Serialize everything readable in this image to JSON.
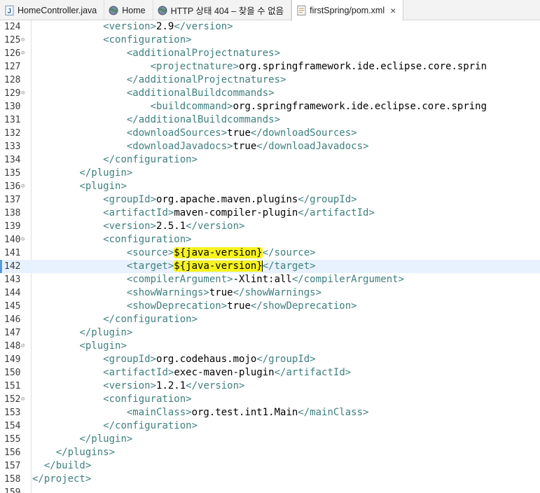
{
  "tabs": [
    {
      "label": "HomeController.java",
      "icon": "java-file-icon",
      "active": false
    },
    {
      "label": "Home",
      "icon": "globe-icon",
      "active": false
    },
    {
      "label": "HTTP 상태 404 – 찾을 수 없음",
      "icon": "globe-icon",
      "active": false
    },
    {
      "label": "firstSpring/pom.xml",
      "icon": "xml-file-icon",
      "active": true,
      "close": "×"
    }
  ],
  "editor": {
    "current_line": 142,
    "lines": [
      {
        "n": "124",
        "fold": false,
        "indent": "            ",
        "parts": [
          [
            "tag",
            "<version>"
          ],
          [
            "txt",
            "2.9"
          ],
          [
            "tag",
            "</version>"
          ]
        ]
      },
      {
        "n": "125",
        "fold": true,
        "indent": "            ",
        "parts": [
          [
            "tag",
            "<configuration>"
          ]
        ]
      },
      {
        "n": "126",
        "fold": true,
        "indent": "                ",
        "parts": [
          [
            "tag",
            "<additionalProjectnatures>"
          ]
        ]
      },
      {
        "n": "127",
        "fold": false,
        "indent": "                    ",
        "parts": [
          [
            "tag",
            "<projectnature>"
          ],
          [
            "txt",
            "org.springframework.ide.eclipse.core.sprin"
          ]
        ]
      },
      {
        "n": "128",
        "fold": false,
        "indent": "                ",
        "parts": [
          [
            "tag",
            "</additionalProjectnatures>"
          ]
        ]
      },
      {
        "n": "129",
        "fold": true,
        "indent": "                ",
        "parts": [
          [
            "tag",
            "<additionalBuildcommands>"
          ]
        ]
      },
      {
        "n": "130",
        "fold": false,
        "indent": "                    ",
        "parts": [
          [
            "tag",
            "<buildcommand>"
          ],
          [
            "txt",
            "org.springframework.ide.eclipse.core.spring"
          ]
        ]
      },
      {
        "n": "131",
        "fold": false,
        "indent": "                ",
        "parts": [
          [
            "tag",
            "</additionalBuildcommands>"
          ]
        ]
      },
      {
        "n": "132",
        "fold": false,
        "indent": "                ",
        "parts": [
          [
            "tag",
            "<downloadSources>"
          ],
          [
            "txt",
            "true"
          ],
          [
            "tag",
            "</downloadSources>"
          ]
        ]
      },
      {
        "n": "133",
        "fold": false,
        "indent": "                ",
        "parts": [
          [
            "tag",
            "<downloadJavadocs>"
          ],
          [
            "txt",
            "true"
          ],
          [
            "tag",
            "</downloadJavadocs>"
          ]
        ]
      },
      {
        "n": "134",
        "fold": false,
        "indent": "            ",
        "parts": [
          [
            "tag",
            "</configuration>"
          ]
        ]
      },
      {
        "n": "135",
        "fold": false,
        "indent": "        ",
        "parts": [
          [
            "tag",
            "</plugin>"
          ]
        ]
      },
      {
        "n": "136",
        "fold": true,
        "indent": "        ",
        "parts": [
          [
            "tag",
            "<plugin>"
          ]
        ]
      },
      {
        "n": "137",
        "fold": false,
        "indent": "            ",
        "parts": [
          [
            "tag",
            "<groupId>"
          ],
          [
            "txt",
            "org.apache.maven.plugins"
          ],
          [
            "tag",
            "</groupId>"
          ]
        ]
      },
      {
        "n": "138",
        "fold": false,
        "indent": "            ",
        "parts": [
          [
            "tag",
            "<artifactId>"
          ],
          [
            "txt",
            "maven-compiler-plugin"
          ],
          [
            "tag",
            "</artifactId>"
          ]
        ]
      },
      {
        "n": "139",
        "fold": false,
        "indent": "            ",
        "parts": [
          [
            "tag",
            "<version>"
          ],
          [
            "txt",
            "2.5.1"
          ],
          [
            "tag",
            "</version>"
          ]
        ]
      },
      {
        "n": "140",
        "fold": true,
        "indent": "            ",
        "parts": [
          [
            "tag",
            "<configuration>"
          ]
        ]
      },
      {
        "n": "141",
        "fold": false,
        "indent": "                ",
        "parts": [
          [
            "tag",
            "<source>"
          ],
          [
            "hl",
            "${java-version}"
          ],
          [
            "tag",
            "</source>"
          ]
        ]
      },
      {
        "n": "142",
        "fold": false,
        "indent": "                ",
        "parts": [
          [
            "tag",
            "<target>"
          ],
          [
            "hl",
            "${java-version}"
          ],
          [
            "caret",
            ""
          ],
          [
            "tag",
            "</target>"
          ]
        ]
      },
      {
        "n": "143",
        "fold": false,
        "indent": "                ",
        "parts": [
          [
            "tag",
            "<compilerArgument>"
          ],
          [
            "txt",
            "-Xlint:all"
          ],
          [
            "tag",
            "</compilerArgument>"
          ]
        ]
      },
      {
        "n": "144",
        "fold": false,
        "indent": "                ",
        "parts": [
          [
            "tag",
            "<showWarnings>"
          ],
          [
            "txt",
            "true"
          ],
          [
            "tag",
            "</showWarnings>"
          ]
        ]
      },
      {
        "n": "145",
        "fold": false,
        "indent": "                ",
        "parts": [
          [
            "tag",
            "<showDeprecation>"
          ],
          [
            "txt",
            "true"
          ],
          [
            "tag",
            "</showDeprecation>"
          ]
        ]
      },
      {
        "n": "146",
        "fold": false,
        "indent": "            ",
        "parts": [
          [
            "tag",
            "</configuration>"
          ]
        ]
      },
      {
        "n": "147",
        "fold": false,
        "indent": "        ",
        "parts": [
          [
            "tag",
            "</plugin>"
          ]
        ]
      },
      {
        "n": "148",
        "fold": true,
        "indent": "        ",
        "parts": [
          [
            "tag",
            "<plugin>"
          ]
        ]
      },
      {
        "n": "149",
        "fold": false,
        "indent": "            ",
        "parts": [
          [
            "tag",
            "<groupId>"
          ],
          [
            "txt",
            "org.codehaus.mojo"
          ],
          [
            "tag",
            "</groupId>"
          ]
        ]
      },
      {
        "n": "150",
        "fold": false,
        "indent": "            ",
        "parts": [
          [
            "tag",
            "<artifactId>"
          ],
          [
            "txt",
            "exec-maven-plugin"
          ],
          [
            "tag",
            "</artifactId>"
          ]
        ]
      },
      {
        "n": "151",
        "fold": false,
        "indent": "            ",
        "parts": [
          [
            "tag",
            "<version>"
          ],
          [
            "txt",
            "1.2.1"
          ],
          [
            "tag",
            "</version>"
          ]
        ]
      },
      {
        "n": "152",
        "fold": true,
        "indent": "            ",
        "parts": [
          [
            "tag",
            "<configuration>"
          ]
        ]
      },
      {
        "n": "153",
        "fold": false,
        "indent": "                ",
        "parts": [
          [
            "tag",
            "<mainClass>"
          ],
          [
            "txt",
            "org.test.int1.Main"
          ],
          [
            "tag",
            "</mainClass>"
          ]
        ]
      },
      {
        "n": "154",
        "fold": false,
        "indent": "            ",
        "parts": [
          [
            "tag",
            "</configuration>"
          ]
        ]
      },
      {
        "n": "155",
        "fold": false,
        "indent": "        ",
        "parts": [
          [
            "tag",
            "</plugin>"
          ]
        ]
      },
      {
        "n": "156",
        "fold": false,
        "indent": "    ",
        "parts": [
          [
            "tag",
            "</plugins>"
          ]
        ]
      },
      {
        "n": "157",
        "fold": false,
        "indent": "  ",
        "parts": [
          [
            "tag",
            "</build>"
          ]
        ]
      },
      {
        "n": "158",
        "fold": false,
        "indent": "",
        "parts": [
          [
            "tag",
            "</project>"
          ]
        ]
      },
      {
        "n": "159",
        "fold": false,
        "indent": "",
        "parts": []
      }
    ]
  },
  "colors": {
    "tag": "#3f7f7f",
    "text": "#000000",
    "highlight": "#f7f31f",
    "current_line": "#e8f2fe"
  }
}
